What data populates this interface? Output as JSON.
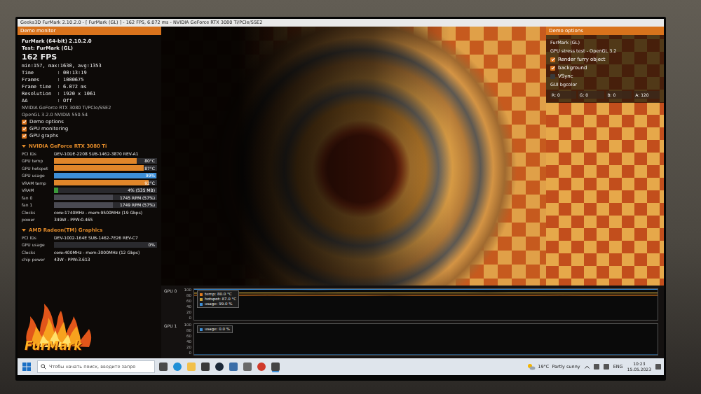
{
  "window": {
    "title": "Geeks3D FurMark 2.10.2.0 - [ FurMark (GL) ] - 162 FPS, 6.072 ms - NVIDIA GeForce RTX 3080 Ti/PCIe/SSE2"
  },
  "demo_monitor": {
    "header": "Demo monitor",
    "lines": [
      {
        "text": "FurMark (64-bit) 2.10.2.0",
        "kind": "title"
      },
      {
        "text": "Test: FurMark (GL)",
        "kind": "title"
      },
      {
        "text": "162 FPS",
        "kind": "fps"
      },
      {
        "text": "min:157, max:1630, avg:1353",
        "kind": "text"
      },
      {
        "text": "Time        : 00:13:19",
        "kind": "text"
      },
      {
        "text": "Frames      : 1000675",
        "kind": "text"
      },
      {
        "text": "Frame time  : 6.072 ms",
        "kind": "text"
      },
      {
        "text": "Resolution  : 1920 x 1061",
        "kind": "text"
      },
      {
        "text": "AA          : Off",
        "kind": "text"
      },
      {
        "text": "NVIDIA GeForce RTX 3080 Ti/PCIe/SSE2",
        "kind": "small"
      },
      {
        "text": "OpenGL 3.2.0 NVIDIA 550.54",
        "kind": "small"
      }
    ],
    "checkboxes": [
      {
        "label": "Demo options",
        "checked": true
      },
      {
        "label": "GPU monitoring",
        "checked": true
      },
      {
        "label": "GPU graphs",
        "checked": true
      }
    ],
    "gpus": [
      {
        "name": "NVIDIA GeForce RTX 3080 Ti",
        "rows": [
          {
            "label": "PCI IDs",
            "value": "DEV-10DE-2208 SUB-1462-3870 REV-A1",
            "kind": "text"
          },
          {
            "label": "GPU temp",
            "value": "80°C",
            "kind": "bar",
            "level": 0.8,
            "color": "#e0862a"
          },
          {
            "label": "GPU hotspot",
            "value": "87°C",
            "kind": "bar",
            "level": 0.87,
            "color": "#e0862a"
          },
          {
            "label": "GPU usage",
            "value": "99%",
            "kind": "bar",
            "level": 0.99,
            "color": "#3d8fd8"
          },
          {
            "label": "VRAM temp",
            "value": "92°C",
            "kind": "bar",
            "level": 0.92,
            "color": "#e0862a"
          },
          {
            "label": "VRAM",
            "value": "4% (535 MB)",
            "kind": "bar",
            "level": 0.04,
            "color": "#3a9a3a"
          },
          {
            "label": "fan 0",
            "value": "1745 RPM (57%)",
            "kind": "bar",
            "level": 0.57,
            "color": "#4a4a52"
          },
          {
            "label": "fan 1",
            "value": "1749 RPM (57%)",
            "kind": "bar",
            "level": 0.57,
            "color": "#4a4a52"
          },
          {
            "label": "Clocks",
            "value": "core:1740MHz - mem:9500MHz (19 Gbps)",
            "kind": "text"
          },
          {
            "label": "power",
            "value": "349W - PPW:0.465",
            "kind": "text"
          }
        ]
      },
      {
        "name": "AMD Radeon(TM) Graphics",
        "rows": [
          {
            "label": "PCI IDs",
            "value": "DEV-1002-164E SUB-1462-7E26 REV-C7",
            "kind": "text"
          },
          {
            "label": "GPU usage",
            "value": "0%",
            "kind": "bar",
            "level": 0.0,
            "color": "#3d8fd8"
          },
          {
            "label": "Clocks",
            "value": "core:400MHz - mem:3000MHz (12 Gbps)",
            "kind": "text"
          },
          {
            "label": "chip power",
            "value": "43W - PPW:3.613",
            "kind": "text"
          }
        ]
      }
    ]
  },
  "logo": {
    "text": "FurMark"
  },
  "demo_options": {
    "header": "Demo options",
    "lines": [
      "FurMark (GL)",
      "GPU stress test - OpenGL 3.2"
    ],
    "checkboxes": [
      {
        "label": "Render furry object",
        "checked": true
      },
      {
        "label": "background",
        "checked": true
      },
      {
        "label": "VSync",
        "checked": false
      }
    ],
    "bgcolor_label": "GUI bgcolor",
    "fields": [
      "R: 0",
      "G: 0",
      "B: 0",
      "A: 120"
    ]
  },
  "graphs": [
    {
      "title": "GPU 0",
      "ticks": [
        "100",
        "80",
        "60",
        "40",
        "20",
        "0"
      ],
      "series": [
        {
          "label": "temp: 80.0 °C",
          "color": "#e07b1f",
          "values": [
            79.6,
            80,
            80,
            80.2,
            80,
            79.8,
            80,
            80,
            80.1,
            80,
            80,
            80,
            79.9,
            80,
            80,
            80.2,
            80,
            80,
            80,
            80
          ]
        },
        {
          "label": "hotspot: 87.0 °C",
          "color": "#c9a13a",
          "values": [
            86.8,
            87,
            87,
            87.1,
            87,
            86.9,
            87,
            87,
            87.2,
            87,
            87,
            87,
            86.9,
            87,
            87,
            87.1,
            87,
            87,
            87,
            87
          ]
        },
        {
          "label": "usage: 99.0 %",
          "color": "#3d8fd8",
          "values": [
            99,
            99,
            99,
            99,
            99,
            98.8,
            99,
            99,
            99,
            99,
            99,
            99,
            99,
            99,
            99,
            99,
            99,
            99,
            99,
            99
          ]
        }
      ]
    },
    {
      "title": "GPU 1",
      "ticks": [
        "100",
        "80",
        "60",
        "40",
        "20",
        "0"
      ],
      "series": [
        {
          "label": "usage: 0.0 %",
          "color": "#3d8fd8",
          "values": [
            0,
            0,
            0,
            0,
            0,
            0,
            0,
            0,
            0,
            0,
            0,
            0,
            0,
            0,
            0,
            0,
            0,
            0,
            0,
            0
          ]
        }
      ]
    }
  ],
  "taskbar": {
    "search_placeholder": "Чтобы начать поиск, введите запро",
    "weather": "19°C  Partly sunny",
    "language": "ENG",
    "time": "10:23",
    "date": "15.05.2023"
  }
}
